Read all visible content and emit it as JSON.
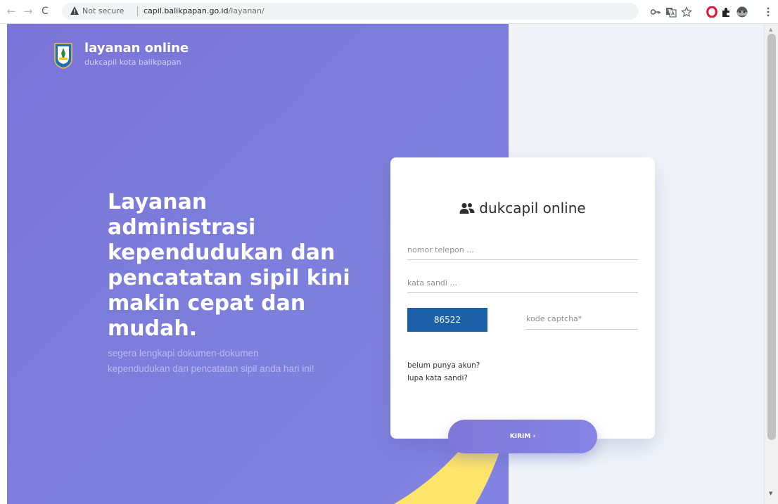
{
  "browser": {
    "back_glyph": "←",
    "forward_glyph": "→",
    "reload_glyph": "C",
    "security_label": "Not secure",
    "url_host": "capil.balikpapan.go.id",
    "url_path": "/layanan/",
    "toolbar_icons": [
      "key-icon",
      "translate-icon",
      "star-icon",
      "opera-icon",
      "extensions-icon",
      "profile-icon",
      "menu-icon"
    ]
  },
  "brand": {
    "title": "layanan online",
    "subtitle": "dukcapil kota balikpapan"
  },
  "hero": {
    "headline": "Layanan administrasi kependudukan dan pencatatan sipil kini makin cepat dan mudah.",
    "subtext_line1": "segera lengkapi dokumen-dokumen",
    "subtext_line2": "kependudukan dan pencatatan sipil anda hari ini!"
  },
  "login": {
    "title": "dukcapil online",
    "phone_placeholder": "nomor telepon ...",
    "password_placeholder": "kata sandi ...",
    "captcha_code": "86522",
    "captcha_placeholder": "kode captcha*",
    "register_link": "belum punya akun?",
    "forgot_link": "lupa kata sandi?",
    "submit_label": "KIRIM ›"
  },
  "colors": {
    "hero_purple": "#7b74d8",
    "accent_yellow": "#fde46a",
    "captcha_blue": "#1c60a8",
    "page_background": "#f0f4f9"
  }
}
